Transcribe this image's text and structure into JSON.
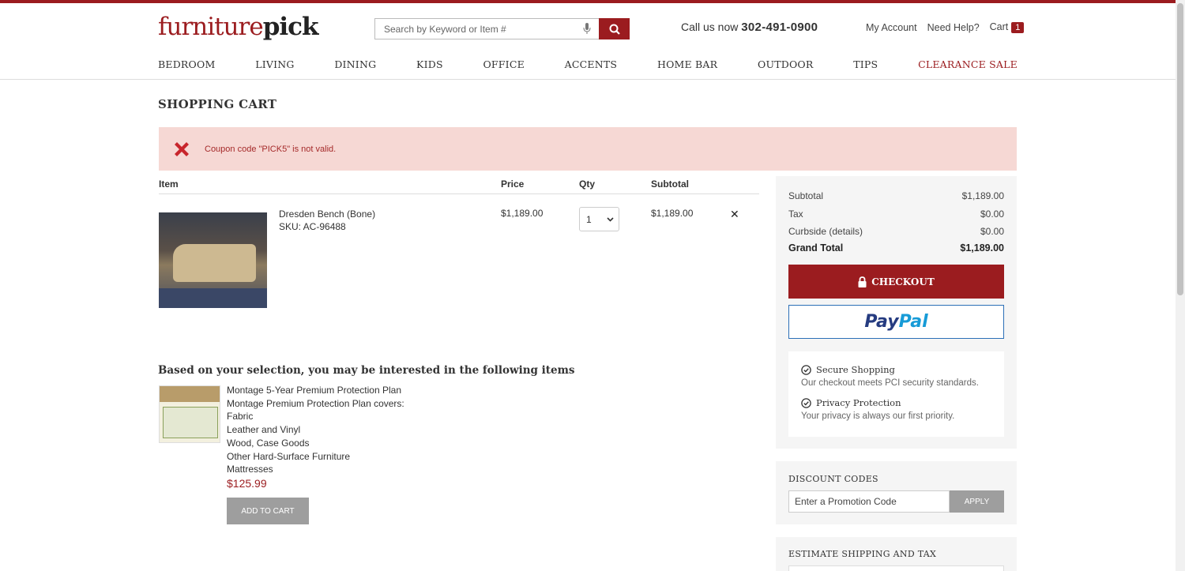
{
  "header": {
    "logo_part1": "furniture",
    "logo_part2": "pick",
    "search_placeholder": "Search by Keyword or Item #",
    "phone_prefix": "Call us now",
    "phone_number": "302-491-0900",
    "my_account": "My Account",
    "need_help": "Need Help?",
    "cart_label": "Cart",
    "cart_count": "1"
  },
  "nav": [
    "BEDROOM",
    "LIVING",
    "DINING",
    "KIDS",
    "OFFICE",
    "ACCENTS",
    "HOME BAR",
    "OUTDOOR",
    "TIPS",
    "CLEARANCE SALE"
  ],
  "page_title": "SHOPPING CART",
  "alert": {
    "message": "Coupon code \"PICK5\" is not valid."
  },
  "table": {
    "headers": {
      "item": "Item",
      "price": "Price",
      "qty": "Qty",
      "subtotal": "Subtotal"
    },
    "rows": [
      {
        "name": "Dresden Bench (Bone)",
        "sku": "SKU: AC-96488",
        "price": "$1,189.00",
        "qty": "1",
        "subtotal": "$1,189.00",
        "remove": "✕"
      }
    ]
  },
  "recommendations": {
    "title": "Based on your selection, you may be interested in the following items",
    "item": {
      "lines": [
        "Montage 5-Year Premium Protection Plan",
        "Montage Premium Protection Plan covers:",
        "Fabric",
        "Leather and Vinyl",
        "Wood, Case Goods",
        "Other Hard-Surface Furniture",
        "Mattresses"
      ],
      "price": "$125.99",
      "button": "ADD TO CART"
    }
  },
  "summary": {
    "subtotal_label": "Subtotal",
    "subtotal": "$1,189.00",
    "tax_label": "Tax",
    "tax": "$0.00",
    "curbside_label": "Curbside (details)",
    "curbside": "$0.00",
    "grand_label": "Grand Total",
    "grand": "$1,189.00",
    "checkout": "CHECKOUT",
    "paypal_1": "Pay",
    "paypal_2": "Pal",
    "secure_title": "Secure Shopping",
    "secure_desc": "Our checkout meets PCI security standards.",
    "privacy_title": "Privacy Protection",
    "privacy_desc": "Your privacy is always our first priority."
  },
  "discount": {
    "title": "DISCOUNT CODES",
    "placeholder": "Enter a Promotion Code",
    "apply": "APPLY"
  },
  "shipping": {
    "title": "ESTIMATE SHIPPING AND TAX"
  },
  "colors": {
    "brand": "#9b1c1f",
    "alert_bg": "#f6d8d4",
    "paypal_dark": "#253b80",
    "paypal_light": "#179bd7"
  },
  "icons": [
    "search-icon",
    "microphone-icon",
    "error-x-icon",
    "lock-icon",
    "check-circle-icon",
    "chevron-down-icon",
    "remove-icon"
  ]
}
